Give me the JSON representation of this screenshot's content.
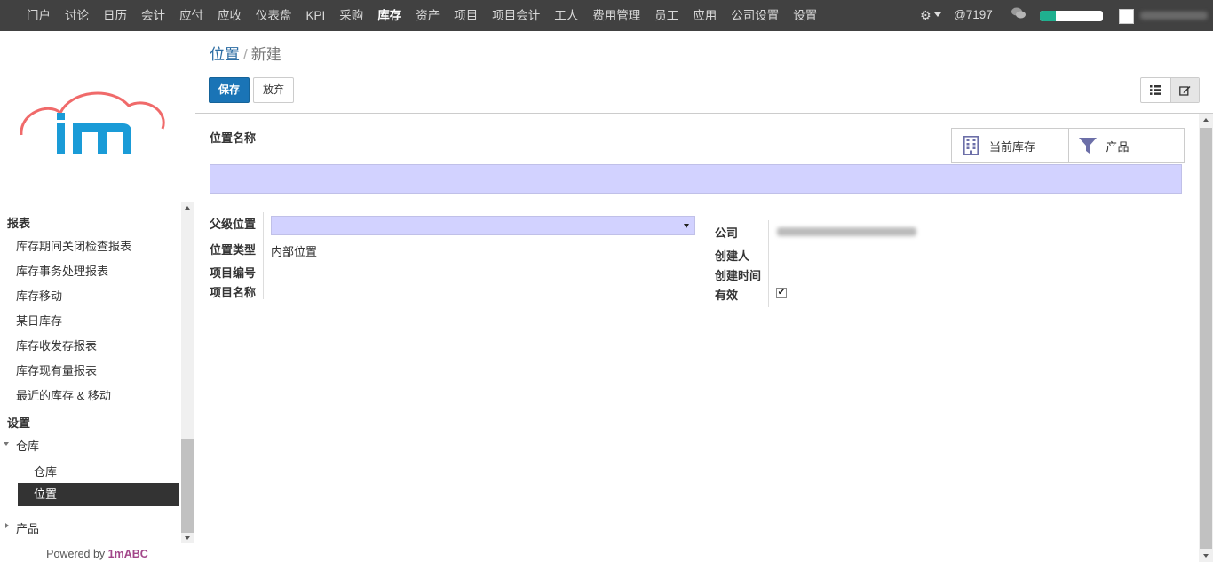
{
  "topbar": {
    "menu": [
      "门户",
      "讨论",
      "日历",
      "会计",
      "应付",
      "应收",
      "仪表盘",
      "KPI",
      "采购",
      "库存",
      "资产",
      "项目",
      "项目会计",
      "工人",
      "费用管理",
      "员工",
      "应用",
      "公司设置",
      "设置"
    ],
    "active": "库存",
    "mentions": "@7197",
    "progress": 0.26,
    "progress_color": "#1fb08f",
    "icons": [
      "gear-icon",
      "caret-down-icon",
      "chat-icon",
      "avatar"
    ]
  },
  "sidebar": {
    "logo_text": "im",
    "reports_heading": "报表",
    "reports": [
      "库存期间关闭检查报表",
      "库存事务处理报表",
      "库存移动",
      "某日库存",
      "库存收发存报表",
      "库存现有量报表",
      "最近的库存 & 移动"
    ],
    "settings_heading": "设置",
    "warehouse_group": "仓库",
    "warehouse_sub": "仓库",
    "location_selected": "位置",
    "products_group": "产品",
    "powered_prefix": "Powered by ",
    "powered_brand": "1mABC"
  },
  "breadcrumb": {
    "parent": "位置",
    "separator": "/",
    "current": "新建"
  },
  "buttons": {
    "save": "保存",
    "discard": "放弃"
  },
  "smart_buttons": {
    "current_stock": "当前库存",
    "products": "产品"
  },
  "form": {
    "name_label": "位置名称",
    "name_value": "",
    "parent_label": "父级位置",
    "parent_value": "",
    "type_label": "位置类型",
    "type_value": "内部位置",
    "project_code_label": "项目编号",
    "project_name_label": "项目名称",
    "company_label": "公司",
    "created_by_label": "创建人",
    "created_time_label": "创建时间",
    "active_label": "有效",
    "active_checked": true
  },
  "colors": {
    "accent": "#1a74b6",
    "required_field": "#d2d2ff",
    "topbar": "#414141",
    "brand": "#a24689"
  }
}
